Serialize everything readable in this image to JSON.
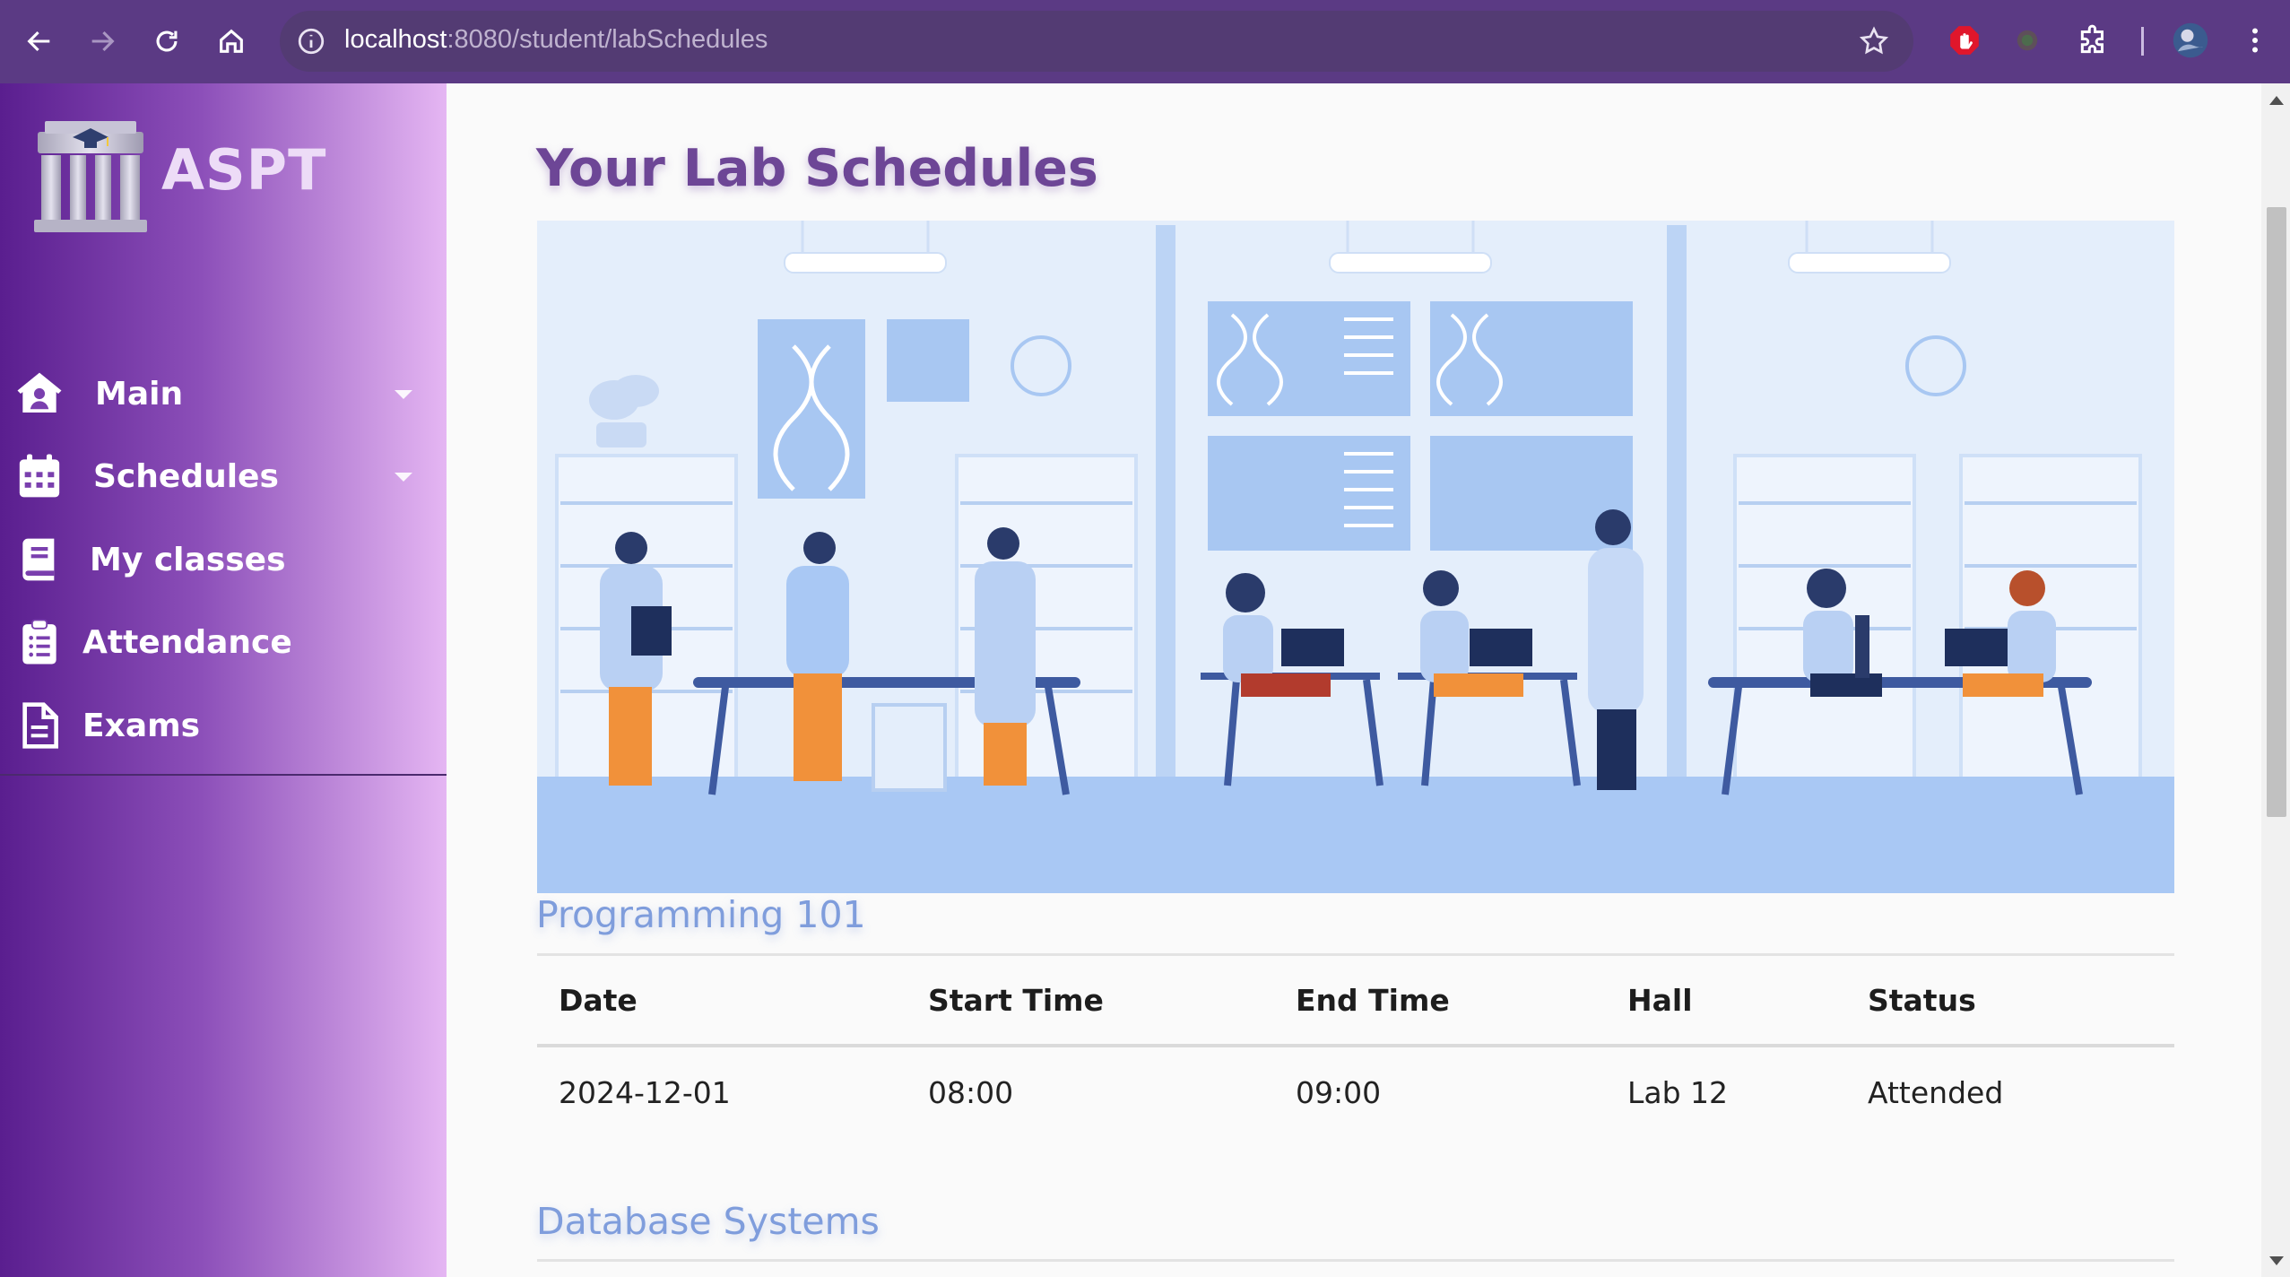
{
  "browser": {
    "url_host": "localhost",
    "url_path": ":8080/student/labSchedules",
    "icons": [
      "back-icon",
      "forward-icon",
      "reload-icon",
      "home-icon",
      "site-info-icon",
      "bookmark-star-icon",
      "ad-block-icon",
      "extension-icon",
      "extensions-puzzle-icon",
      "profile-avatar",
      "kebab-menu-icon"
    ]
  },
  "sidebar": {
    "brand": "ASPT",
    "items": [
      {
        "label": "Main",
        "icon": "home-user-icon",
        "has_caret": true
      },
      {
        "label": "Schedules",
        "icon": "calendar-icon",
        "has_caret": true
      },
      {
        "label": "My classes",
        "icon": "book-icon",
        "has_caret": false
      },
      {
        "label": "Attendance",
        "icon": "clipboard-list-icon",
        "has_caret": false
      },
      {
        "label": "Exams",
        "icon": "document-icon",
        "has_caret": false
      }
    ]
  },
  "main": {
    "title": "Your Lab Schedules",
    "banner_alt": "laboratory-illustration",
    "courses": [
      {
        "name": "Programming 101",
        "columns": [
          "Date",
          "Start Time",
          "End Time",
          "Hall",
          "Status"
        ],
        "rows": [
          {
            "date": "2024-12-01",
            "start": "08:00",
            "end": "09:00",
            "hall": "Lab 12",
            "status": "Attended"
          }
        ]
      },
      {
        "name": "Database Systems"
      }
    ]
  },
  "colors": {
    "chrome": "#5b3a84",
    "title": "#6d4696",
    "section": "#7f9ddc",
    "attended": "#2a8a12",
    "sidebar_start": "#5a1e8f",
    "sidebar_end": "#e5b6f3"
  }
}
